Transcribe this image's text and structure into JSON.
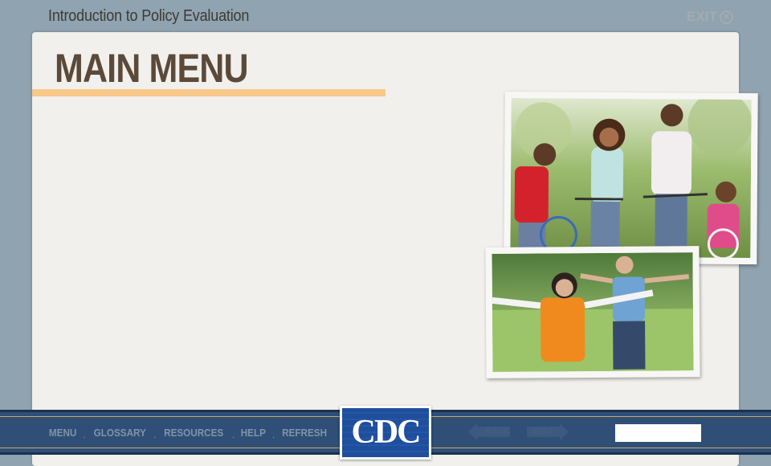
{
  "header": {
    "course_title": "Introduction to Policy Evaluation",
    "exit_label": "EXIT",
    "exit_icon": "circle-x-icon"
  },
  "main": {
    "title": "MAIN MENU",
    "accent_color": "#f9c98a"
  },
  "photos": [
    {
      "name": "family-biking-photo"
    },
    {
      "name": "seniors-exercising-photo"
    }
  ],
  "footer": {
    "nav_items": [
      {
        "key": "menu",
        "label": "MENU"
      },
      {
        "key": "glossary",
        "label": "GLOSSARY"
      },
      {
        "key": "resources",
        "label": "RESOURCES"
      },
      {
        "key": "help",
        "label": "HELP"
      },
      {
        "key": "refresh",
        "label": "REFRESH"
      }
    ],
    "logo_text": "CDC",
    "back_label": "BACK",
    "next_label": "NEXT",
    "bar_color": "#2f4f76"
  }
}
